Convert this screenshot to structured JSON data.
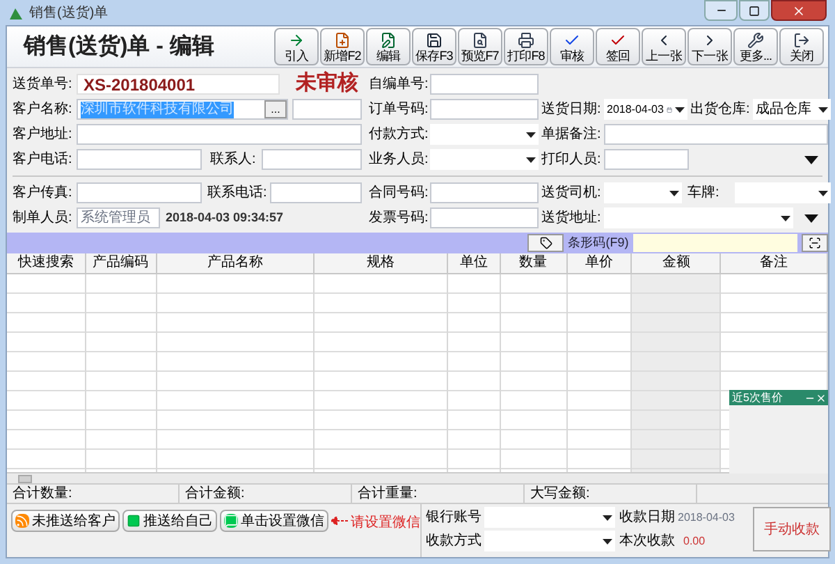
{
  "window": {
    "title": "销售(送货)单"
  },
  "header": {
    "title": "销售(送货)单 - 编辑"
  },
  "toolbar": [
    {
      "label": "引入"
    },
    {
      "label": "新增F2"
    },
    {
      "label": "编辑"
    },
    {
      "label": "保存F3"
    },
    {
      "label": "预览F7"
    },
    {
      "label": "打印F8"
    },
    {
      "label": "审核"
    },
    {
      "label": "签回"
    },
    {
      "label": "上一张"
    },
    {
      "label": "下一张"
    },
    {
      "label": "更多..."
    },
    {
      "label": "关闭"
    }
  ],
  "form": {
    "rows": [
      {
        "left": [
          {
            "kind": "label",
            "text": "送货单号:"
          },
          {
            "kind": "number",
            "value": "XS-201804001"
          },
          {
            "kind": "status",
            "text": "未审核"
          }
        ],
        "middle": [
          {
            "kind": "label",
            "text": "自编单号:"
          },
          {
            "kind": "input"
          }
        ]
      },
      {
        "left": [
          {
            "kind": "label",
            "text": "客户名称:"
          },
          {
            "kind": "picker",
            "value": "深圳市软件科技有限公司",
            "button": "..."
          },
          {
            "kind": "input"
          }
        ],
        "middle": [
          {
            "kind": "label",
            "text": "订单号码:"
          },
          {
            "kind": "input"
          }
        ],
        "right": [
          {
            "kind": "label",
            "text": "送货日期:"
          },
          {
            "kind": "date",
            "value": "2018-04-03"
          },
          {
            "kind": "label",
            "text": "出货仓库:"
          },
          {
            "kind": "dropdown",
            "value": "成品仓库"
          }
        ]
      },
      {
        "left": [
          {
            "kind": "label",
            "text": "客户地址:"
          },
          {
            "kind": "input"
          }
        ],
        "middle": [
          {
            "kind": "label",
            "text": "付款方式:"
          },
          {
            "kind": "dropdown"
          }
        ],
        "right": [
          {
            "kind": "label",
            "text": "单据备注:"
          },
          {
            "kind": "input"
          }
        ]
      },
      {
        "left": [
          {
            "kind": "label",
            "text": "客户电话:"
          },
          {
            "kind": "input"
          },
          {
            "kind": "label",
            "text": "联系人:"
          },
          {
            "kind": "input"
          }
        ],
        "middle": [
          {
            "kind": "label",
            "text": "业务人员:"
          },
          {
            "kind": "dropdown"
          }
        ],
        "right": [
          {
            "kind": "label",
            "text": "打印人员:"
          },
          {
            "kind": "input"
          },
          {
            "kind": "arrow"
          }
        ]
      },
      {
        "left": [
          {
            "kind": "label",
            "text": "客户传真:"
          },
          {
            "kind": "input"
          },
          {
            "kind": "label",
            "text": "联系电话:"
          },
          {
            "kind": "input"
          }
        ],
        "middle": [
          {
            "kind": "label",
            "text": "合同号码:"
          },
          {
            "kind": "input"
          }
        ],
        "right": [
          {
            "kind": "label",
            "text": "送货司机:"
          },
          {
            "kind": "dropdown"
          },
          {
            "kind": "label",
            "text": "车牌:"
          },
          {
            "kind": "dropdown"
          }
        ]
      },
      {
        "left": [
          {
            "kind": "label",
            "text": "制单人员:"
          },
          {
            "kind": "input",
            "value": "系统管理员",
            "disabled": true
          },
          {
            "kind": "text",
            "text": "2018-04-03 09:34:57"
          }
        ],
        "middle": [
          {
            "kind": "label",
            "text": "发票号码:"
          },
          {
            "kind": "input"
          }
        ],
        "right": [
          {
            "kind": "label",
            "text": "送货地址:"
          },
          {
            "kind": "dropdown"
          },
          {
            "kind": "arrow"
          }
        ]
      }
    ]
  },
  "barcode": {
    "label": "条形码(F9)"
  },
  "table": {
    "columns": [
      "快速搜索",
      "产品编码",
      "产品名称",
      "规格",
      "单位",
      "数量",
      "单价",
      "金额",
      "备注"
    ]
  },
  "side_panel": {
    "title": "近5次售价"
  },
  "totals": [
    "合计数量:",
    "合计金额:",
    "合计重量:",
    "大写金额:"
  ],
  "actions": [
    {
      "label": "未推送给客户"
    },
    {
      "label": "推送给自己"
    },
    {
      "label": "单击设置微信"
    }
  ],
  "hint": "请设置微信",
  "payment": {
    "bank_label": "银行账号",
    "date_label": "收款日期",
    "date_value": "2018-04-03",
    "method_label": "收款方式",
    "amount_label": "本次收款",
    "amount_value": "0.00",
    "button": "手动收款"
  }
}
